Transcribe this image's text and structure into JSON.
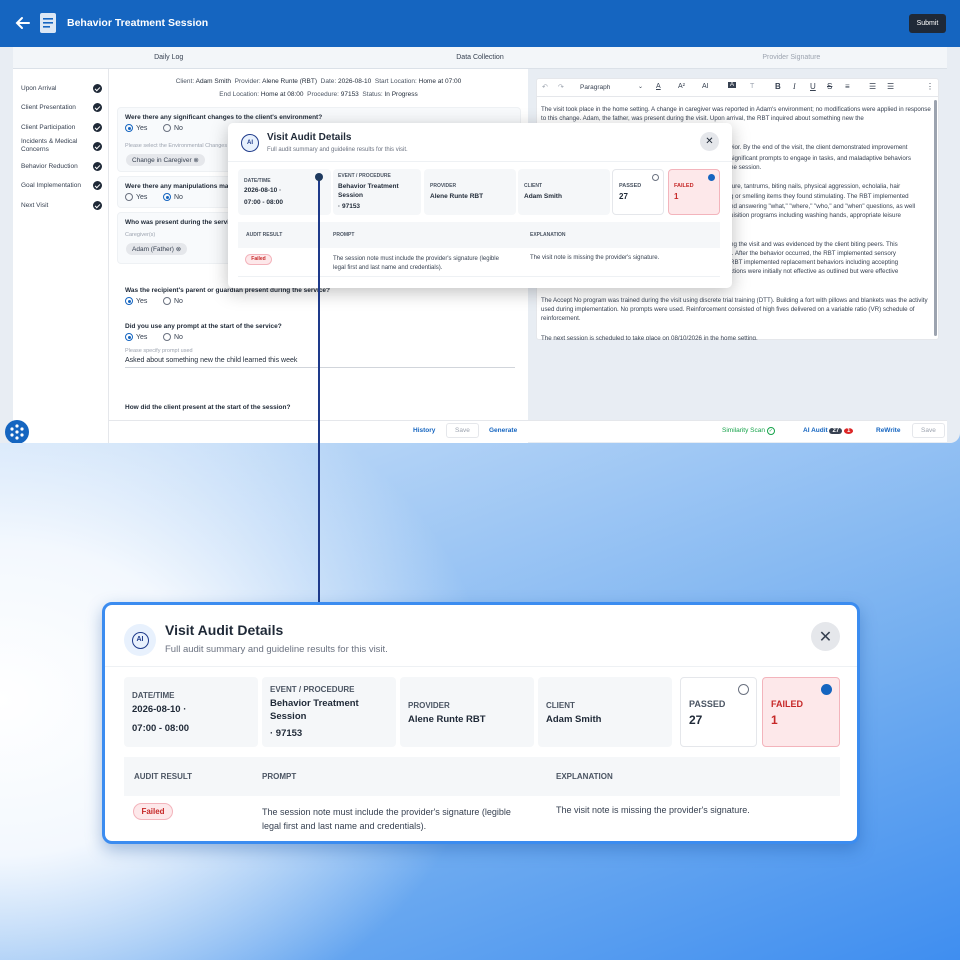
{
  "header": {
    "title": "Behavior Treatment Session",
    "submit_label": "Submit"
  },
  "tabs": [
    "Daily Log",
    "Data Collection",
    "Provider Signature"
  ],
  "sidebar": {
    "items": [
      {
        "label": "Upon Arrival"
      },
      {
        "label": "Client Presentation"
      },
      {
        "label": "Client Participation"
      },
      {
        "label": "Incidents & Medical Concerns"
      },
      {
        "label": "Behavior Reduction"
      },
      {
        "label": "Goal Implementation"
      },
      {
        "label": "Next Visit"
      }
    ]
  },
  "meta": {
    "client_label": "Client:",
    "client": "Adam Smith",
    "provider_label": "Provider:",
    "provider": "Alene Runte (RBT)",
    "date_label": "Date:",
    "date": "2026-08-10",
    "start_label": "Start Location:",
    "start": "Home at 07:00",
    "end_label": "End Location:",
    "end": "Home at 08:00",
    "procedure_label": "Procedure:",
    "procedure": "97153",
    "status_label": "Status:",
    "status": "In Progress"
  },
  "form": {
    "q1": "Were there any significant changes to the client's environment?",
    "yes": "Yes",
    "no": "No",
    "q1_hint": "Please select the Environmental Changes",
    "q1_chip": "Change in Caregiver",
    "q2": "Were there any manipulations made",
    "q3": "Who was present during the service",
    "q3_hint": "Caregiver(s)",
    "q3_chip": "Adam (Father)",
    "q4": "Was the recipient's parent or guardian present during the service?",
    "q5": "Did you use any prompt at the start of the service?",
    "q5_hint": "Please specify prompt used",
    "q5_answer": "Asked about something new the child learned this week",
    "q6": "How did the client present at the start of the session?"
  },
  "form_actions": {
    "history": "History",
    "save": "Save",
    "generate": "Generate"
  },
  "editor": {
    "block_style": "Paragraph",
    "p1": "The visit took place in the home setting. A change in caregiver was reported in Adam's environment; no modifications were applied in response to this change. Adam, the father, was present during the visit. Upon arrival, the RBT inquired about something new the",
    "p2": "The Accept No program was trained during the visit using discrete trial training (DTT). Building a fort with pillows and blankets was the activity used during implementation. No prompts were used. Reinforcement consisted of high fives delivered on a variable ratio (VR) schedule of reinforcement.",
    "p3": "The next session is scheduled to take place on 08/10/2026 in the home setting.",
    "frag1": "vior. By the end of the visit, the client demonstrated improvement",
    "frag2": "significant prompts to engage in tasks, and maladaptive behaviors",
    "frag3": "he session.",
    "frag4": "ture, tantrums, biting nails, physical aggression, echolalia, hair",
    "frag5": "g or smelling items they found stimulating. The RBT implemented",
    "frag6": "RBT implemented replacement behaviors including accepting",
    "frag7": "nd answering \"what,\" \"where,\" \"who,\" and \"when\" questions, as well",
    "frag8": "uisition programs including washing hands, appropriate leisure",
    "frag9": "ng the visit and was evidenced by the client biting peers. This",
    "frag10": "r. After the behavior occurred, the RBT implemented sensory",
    "frag11": "ctions were initially not effective as outlined but were effective"
  },
  "editor_actions": {
    "similarity": "Similarity Scan",
    "ai_audit": "AI Audit",
    "passed_count": "27",
    "failed_count": "1",
    "rewrite": "ReWrite",
    "save": "Save"
  },
  "modal": {
    "icon_text": "AI",
    "title": "Visit Audit Details",
    "subtitle": "Full audit summary and guideline results for this visit.",
    "datetime_label": "DATE/TIME",
    "date": "2026-08-10",
    "date_sep": "·",
    "time": "07:00 - 08:00",
    "event_label": "EVENT / PROCEDURE",
    "event": "Behavior Treatment Session",
    "procedure": "· 97153",
    "provider_label": "PROVIDER",
    "provider": "Alene Runte RBT",
    "client_label": "CLIENT",
    "client": "Adam Smith",
    "passed_label": "PASSED",
    "passed": "27",
    "failed_label": "FAILED",
    "failed": "1",
    "col_result": "AUDIT RESULT",
    "col_prompt": "PROMPT",
    "col_explanation": "EXPLANATION",
    "row_result": "Failed",
    "row_prompt_1": "The session note must include the provider's signature (legible",
    "row_prompt_2": "legal first and last name and credentials).",
    "row_explanation": "The visit note is missing the provider's signature."
  },
  "colors": {
    "primary": "#1565c0",
    "fail_bg": "#fde8ea",
    "fail_text": "#c62828",
    "zoom_border": "#3b8cf0"
  }
}
